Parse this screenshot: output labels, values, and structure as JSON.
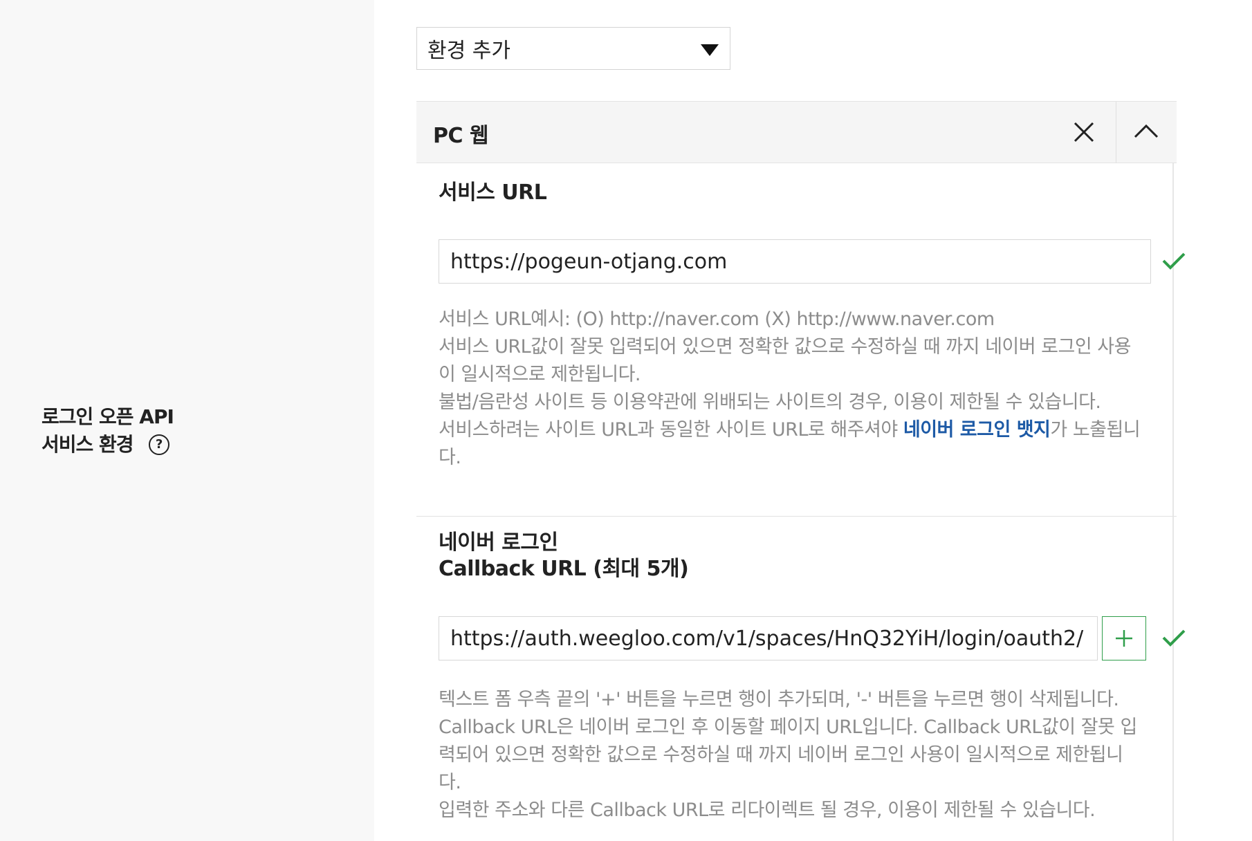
{
  "sidebar": {
    "label_line1": "로그인 오픈 API",
    "label_line2": "서비스 환경",
    "help_glyph": "?"
  },
  "env_select": {
    "value": "환경 추가"
  },
  "environment": {
    "title": "PC 웹",
    "service_url": {
      "title": "서비스 URL",
      "value": "https://pogeun-otjang.com",
      "help_lines": [
        "서비스 URL예시: (O) http://naver.com (X) http://www.naver.com",
        "서비스 URL값이 잘못 입력되어 있으면 정확한 값으로 수정하실 때 까지 네이버 로그인 사용",
        "이 일시적으로 제한됩니다.",
        "불법/음란성 사이트 등 이용약관에 위배되는 사이트의 경우, 이용이 제한될 수 있습니다."
      ],
      "badge_line_before": "서비스하려는 사이트 URL과 동일한 사이트 URL로 해주셔야 ",
      "badge_link": "네이버 로그인 뱃지",
      "badge_line_after": "가 노출됩니",
      "badge_line_end": "다."
    },
    "callback_url": {
      "title_line1": "네이버 로그인",
      "title_line2": "Callback URL (최대 5개)",
      "value": "https://auth.weegloo.com/v1/spaces/HnQ32YiH/login/oauth2/",
      "add_glyph": "+",
      "help_lines": [
        "텍스트 폼 우측 끝의 '+' 버튼을 누르면 행이 추가되며, '-' 버튼을 누르면 행이 삭제됩니다.",
        "Callback URL은 네이버 로그인 후 이동할 페이지 URL입니다. Callback URL값이 잘못 입",
        "력되어 있으면 정확한 값으로 수정하실 때 까지 네이버 로그인 사용이 일시적으로 제한됩니",
        "다.",
        "입력한 주소와 다른 Callback URL로 리다이렉트 될 경우, 이용이 제한될 수 있습니다."
      ]
    }
  },
  "colors": {
    "check_green": "#2f9e4a",
    "link_blue": "#1d5aa6",
    "help_gray": "#8c8c8c",
    "sidebar_bg": "#f8f8f8"
  },
  "icons": {
    "dropdown": "caret-down-icon",
    "close": "close-icon",
    "collapse": "chevron-up-icon",
    "valid": "check-icon",
    "add": "plus-icon",
    "help": "question-circle-icon"
  }
}
